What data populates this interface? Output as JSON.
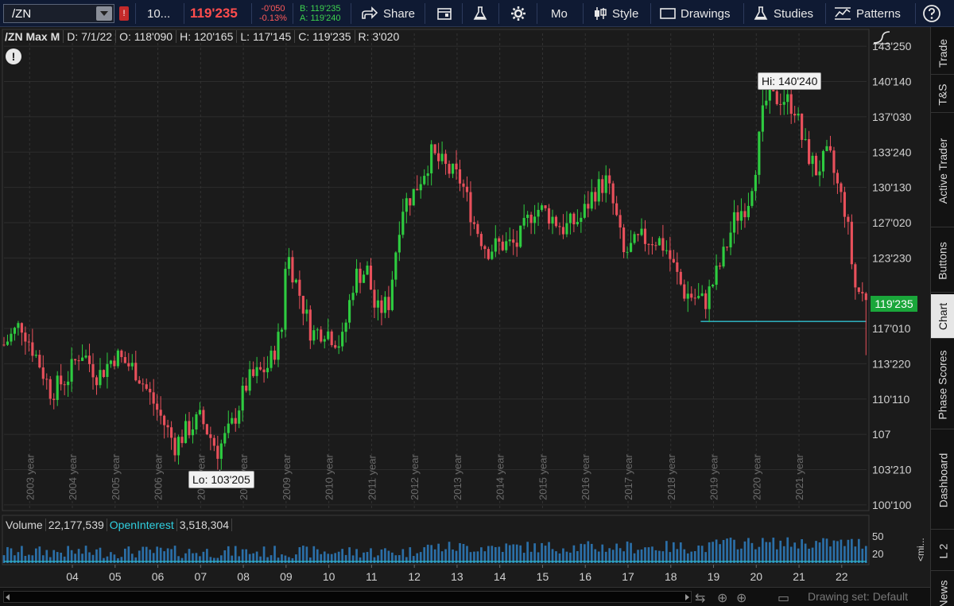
{
  "toolbar": {
    "symbol": "/ZN",
    "alert_badge": "!",
    "qty": "10...",
    "last_price": "119'235",
    "net_change": "-0'050",
    "pct_change": "-0.13%",
    "bid": "B: 119'235",
    "ask": "A: 119'240",
    "share": "Share",
    "period": "Mo",
    "style": "Style",
    "drawings": "Drawings",
    "studies": "Studies",
    "patterns": "Patterns"
  },
  "info": {
    "symbol_range": "/ZN Max M",
    "date": "D: 7/1/22",
    "open": "O: 118'090",
    "high": "H: 120'165",
    "low": "L: 117'145",
    "close": "C: 119'235",
    "range": "R: 3'020"
  },
  "annotations": {
    "hi": "Hi: 140'240",
    "lo": "Lo: 103'205",
    "last": "119'235"
  },
  "volume": {
    "label": "Volume",
    "value": "22,177,539",
    "oi_label": "OpenInterest",
    "oi_value": "3,518,304",
    "axis_top": "50",
    "axis_mid": "20",
    "axis_unit": "<mi..."
  },
  "sidebar": {
    "tabs": [
      "Trade",
      "T&S",
      "Active Trader",
      "Buttons",
      "Chart",
      "Phase Scores",
      "Dashboard",
      "L 2",
      "News"
    ],
    "active": "Chart"
  },
  "bottom": {
    "drawing_set": "Drawing set: Default"
  },
  "colors": {
    "up": "#2ecc40",
    "down": "#e8505b",
    "support_line": "#30c0d0",
    "last_tag": "#1aa63a",
    "accent_price": "#ff4d4d"
  },
  "chart_data": {
    "type": "candlestick",
    "title": "/ZN Max M",
    "y_ticks": [
      "143'250",
      "140'140",
      "137'030",
      "133'240",
      "130'130",
      "127'020",
      "123'230",
      "117'010",
      "113'220",
      "110'110",
      "107",
      "103'210",
      "100'100"
    ],
    "ylim": [
      100.0,
      145.0
    ],
    "year_labels": [
      "2003 year",
      "2004 year",
      "2005 year",
      "2006 year",
      "2007 year",
      "2008 year",
      "2009 year",
      "2010 year",
      "2011 year",
      "2012 year",
      "2013 year",
      "2014 year",
      "2015 year",
      "2016 year",
      "2017 year",
      "2018 year",
      "2019 year",
      "2020 year",
      "2021 year"
    ],
    "x_ticks": [
      "04",
      "05",
      "06",
      "07",
      "08",
      "09",
      "10",
      "11",
      "12",
      "13",
      "14",
      "15",
      "16",
      "17",
      "18",
      "19",
      "20",
      "21",
      "22"
    ],
    "start_year": 2002.4,
    "end_year": 2022.58,
    "hi_value": 140.75,
    "lo_value": 103.64,
    "last_value": 119.73,
    "support_level": 117.7,
    "support_from_year": 2018.7,
    "anchors": [
      [
        2002.4,
        115.5
      ],
      [
        2002.8,
        117.5
      ],
      [
        2003.2,
        114.0
      ],
      [
        2003.5,
        111.0
      ],
      [
        2003.9,
        112.5
      ],
      [
        2004.2,
        115.0
      ],
      [
        2004.6,
        112.5
      ],
      [
        2005.0,
        114.5
      ],
      [
        2005.5,
        113.0
      ],
      [
        2005.9,
        110.0
      ],
      [
        2006.4,
        106.0
      ],
      [
        2006.7,
        107.5
      ],
      [
        2007.0,
        108.5
      ],
      [
        2007.4,
        105.5
      ],
      [
        2007.7,
        107.5
      ],
      [
        2008.1,
        112.0
      ],
      [
        2008.6,
        113.5
      ],
      [
        2008.9,
        117.0
      ],
      [
        2009.0,
        124.5
      ],
      [
        2009.3,
        120.5
      ],
      [
        2009.6,
        116.5
      ],
      [
        2009.9,
        117.0
      ],
      [
        2010.3,
        115.5
      ],
      [
        2010.6,
        122.0
      ],
      [
        2010.9,
        122.5
      ],
      [
        2011.1,
        118.5
      ],
      [
        2011.4,
        119.5
      ],
      [
        2011.7,
        128.5
      ],
      [
        2012.0,
        130.0
      ],
      [
        2012.4,
        133.5
      ],
      [
        2012.8,
        132.0
      ],
      [
        2013.1,
        131.0
      ],
      [
        2013.4,
        127.0
      ],
      [
        2013.7,
        124.5
      ],
      [
        2014.0,
        125.0
      ],
      [
        2014.4,
        125.0
      ],
      [
        2014.8,
        128.5
      ],
      [
        2015.1,
        128.0
      ],
      [
        2015.5,
        126.5
      ],
      [
        2015.9,
        127.5
      ],
      [
        2016.2,
        130.0
      ],
      [
        2016.5,
        131.0
      ],
      [
        2016.7,
        128.0
      ],
      [
        2016.9,
        124.0
      ],
      [
        2017.3,
        125.5
      ],
      [
        2017.7,
        125.5
      ],
      [
        2017.9,
        124.5
      ],
      [
        2018.3,
        120.5
      ],
      [
        2018.8,
        119.5
      ],
      [
        2019.2,
        123.5
      ],
      [
        2019.5,
        127.5
      ],
      [
        2019.8,
        129.0
      ],
      [
        2020.0,
        133.0
      ],
      [
        2020.2,
        138.5
      ],
      [
        2020.6,
        139.0
      ],
      [
        2020.9,
        138.0
      ],
      [
        2021.1,
        134.5
      ],
      [
        2021.4,
        132.0
      ],
      [
        2021.7,
        133.5
      ],
      [
        2021.9,
        130.5
      ],
      [
        2022.1,
        128.0
      ],
      [
        2022.3,
        121.0
      ],
      [
        2022.58,
        119.7
      ]
    ]
  }
}
